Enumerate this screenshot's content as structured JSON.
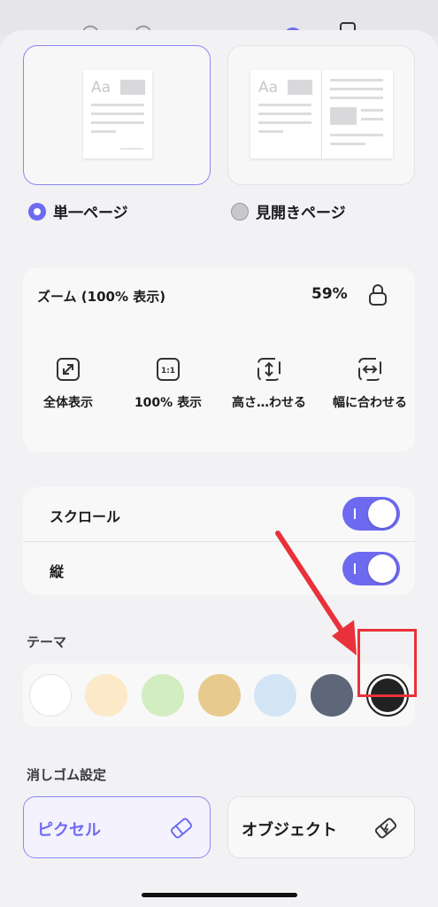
{
  "layout": {
    "single_label": "単一ページ",
    "spread_label": "見開きページ",
    "preview_aa": "Aa",
    "selected": "single"
  },
  "zoom": {
    "title": "ズーム (100% 表示)",
    "value": "59%",
    "buttons": [
      {
        "label": "全体表示",
        "icon": "fit-all-icon"
      },
      {
        "label": "100% 表示",
        "icon": "actual-size-icon"
      },
      {
        "label": "高さ…わせる",
        "icon": "fit-height-icon"
      },
      {
        "label": "幅に合わせる",
        "icon": "fit-width-icon"
      }
    ]
  },
  "toggles": [
    {
      "label": "スクロール",
      "on": true
    },
    {
      "label": "縦",
      "on": true
    }
  ],
  "theme": {
    "label": "テーマ",
    "swatches": [
      "#ffffff",
      "#fbe9c8",
      "#d2edc0",
      "#e8c98e",
      "#d3e5f5",
      "#5e6777",
      "#222222"
    ],
    "selected_index": 6
  },
  "eraser": {
    "label": "消しゴム設定",
    "options": [
      {
        "label": "ピクセル",
        "icon": "eraser-icon",
        "selected": true
      },
      {
        "label": "オブジェクト",
        "icon": "object-eraser-icon",
        "selected": false
      }
    ]
  },
  "colors": {
    "accent": "#6e6af0",
    "annotation": "#e8313a"
  }
}
